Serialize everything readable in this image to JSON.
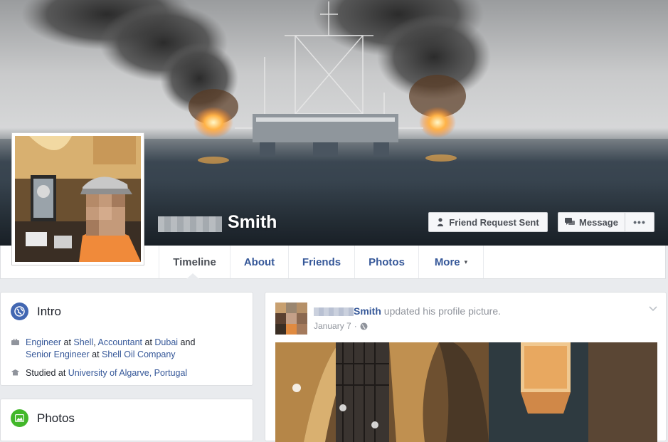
{
  "profile": {
    "name": "Smith",
    "friend_button": "Friend Request Sent",
    "message_button": "Message",
    "more_button": "•••"
  },
  "nav": {
    "tabs": [
      {
        "label": "Timeline",
        "active": true
      },
      {
        "label": "About"
      },
      {
        "label": "Friends"
      },
      {
        "label": "Photos"
      },
      {
        "label": "More"
      }
    ],
    "more_caret": "▾"
  },
  "intro": {
    "title": "Intro",
    "work": {
      "t1": "Engineer",
      "t2": " at ",
      "t3": "Shell",
      "t4": ", ",
      "t5": "Accountant",
      "t6": " at ",
      "t7": "Dubai",
      "t8": " and",
      "t9": "Senior Engineer",
      "t10": " at ",
      "t11": "Shell Oil Company"
    },
    "education": {
      "prefix": "Studied at ",
      "school": "University of Algarve, Portugal"
    }
  },
  "photos": {
    "title": "Photos"
  },
  "post": {
    "author": "Smith",
    "action": " updated his profile picture.",
    "date": "January 7",
    "separator": "·"
  },
  "icons": {
    "intro": "globe-icon",
    "photos": "photo-icon",
    "work": "briefcase-icon",
    "education": "graduation-cap-icon",
    "friend": "person-add-icon",
    "message": "message-icon",
    "privacy": "globe-icon",
    "options": "chevron-down-icon"
  },
  "colors": {
    "link": "#365899",
    "intro_icon": "#4267b2",
    "photos_icon": "#42b72a",
    "page_bg": "#e9ebee"
  }
}
